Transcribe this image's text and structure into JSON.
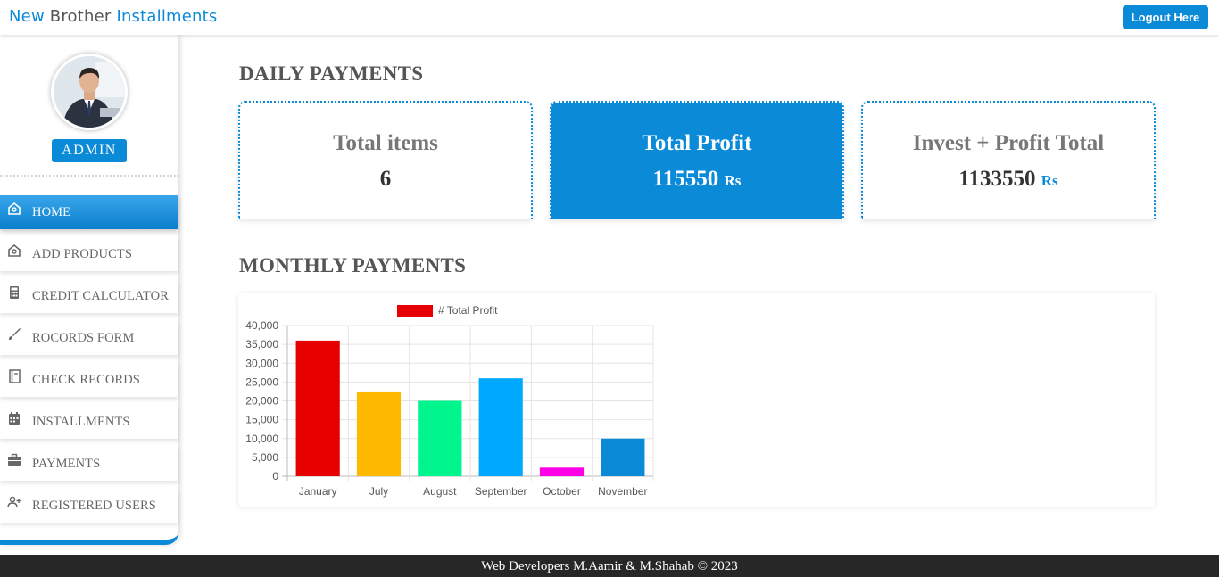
{
  "header": {
    "brand": [
      "New",
      "Brother",
      "Installments"
    ],
    "logout_label": "Logout Here"
  },
  "sidebar": {
    "role_badge": "ADMIN",
    "items": [
      {
        "label": "HOME",
        "icon": "home-icon",
        "active": true
      },
      {
        "label": "ADD PRODUCTS",
        "icon": "home-icon",
        "active": false
      },
      {
        "label": "CREDIT CALCULATOR",
        "icon": "calculator-icon",
        "active": false
      },
      {
        "label": "ROCORDS FORM",
        "icon": "brush-icon",
        "active": false
      },
      {
        "label": "CHECK RECORDS",
        "icon": "notebook-icon",
        "active": false
      },
      {
        "label": "INSTALLMENTS",
        "icon": "calendar-icon",
        "active": false
      },
      {
        "label": "PAYMENTS",
        "icon": "briefcase-icon",
        "active": false
      },
      {
        "label": "REGISTERED USERS",
        "icon": "user-add-icon",
        "active": false
      }
    ]
  },
  "daily": {
    "title": "DAILY PAYMENTS",
    "cards": [
      {
        "title": "Total items",
        "value": "6",
        "unit": ""
      },
      {
        "title": "Total Profit",
        "value": "115550",
        "unit": "Rs"
      },
      {
        "title": "Invest + Profit Total",
        "value": "1133550",
        "unit": "Rs"
      }
    ]
  },
  "monthly": {
    "title": "MONTHLY PAYMENTS"
  },
  "chart_data": {
    "type": "bar",
    "categories": [
      "January",
      "July",
      "August",
      "September",
      "October",
      "November"
    ],
    "series": [
      {
        "name": "# Total Profit",
        "values": [
          36000,
          22500,
          20000,
          26000,
          2300,
          10000
        ]
      }
    ],
    "bar_colors": [
      "#e60000",
      "#ffb900",
      "#00f58c",
      "#00a9ff",
      "#ff00e6",
      "#0b8ad8"
    ],
    "legend_color": "#e60000",
    "ylim": [
      0,
      40000
    ],
    "yticks": [
      "0",
      "5,000",
      "10,000",
      "15,000",
      "20,000",
      "25,000",
      "30,000",
      "35,000",
      "40,000"
    ],
    "legend": "top",
    "grid": true
  },
  "footer": {
    "text": "Web Developers M.Aamir & M.Shahab © 2023"
  },
  "colors": {
    "accent": "#0b8ad8",
    "footer_bg": "#272727"
  }
}
